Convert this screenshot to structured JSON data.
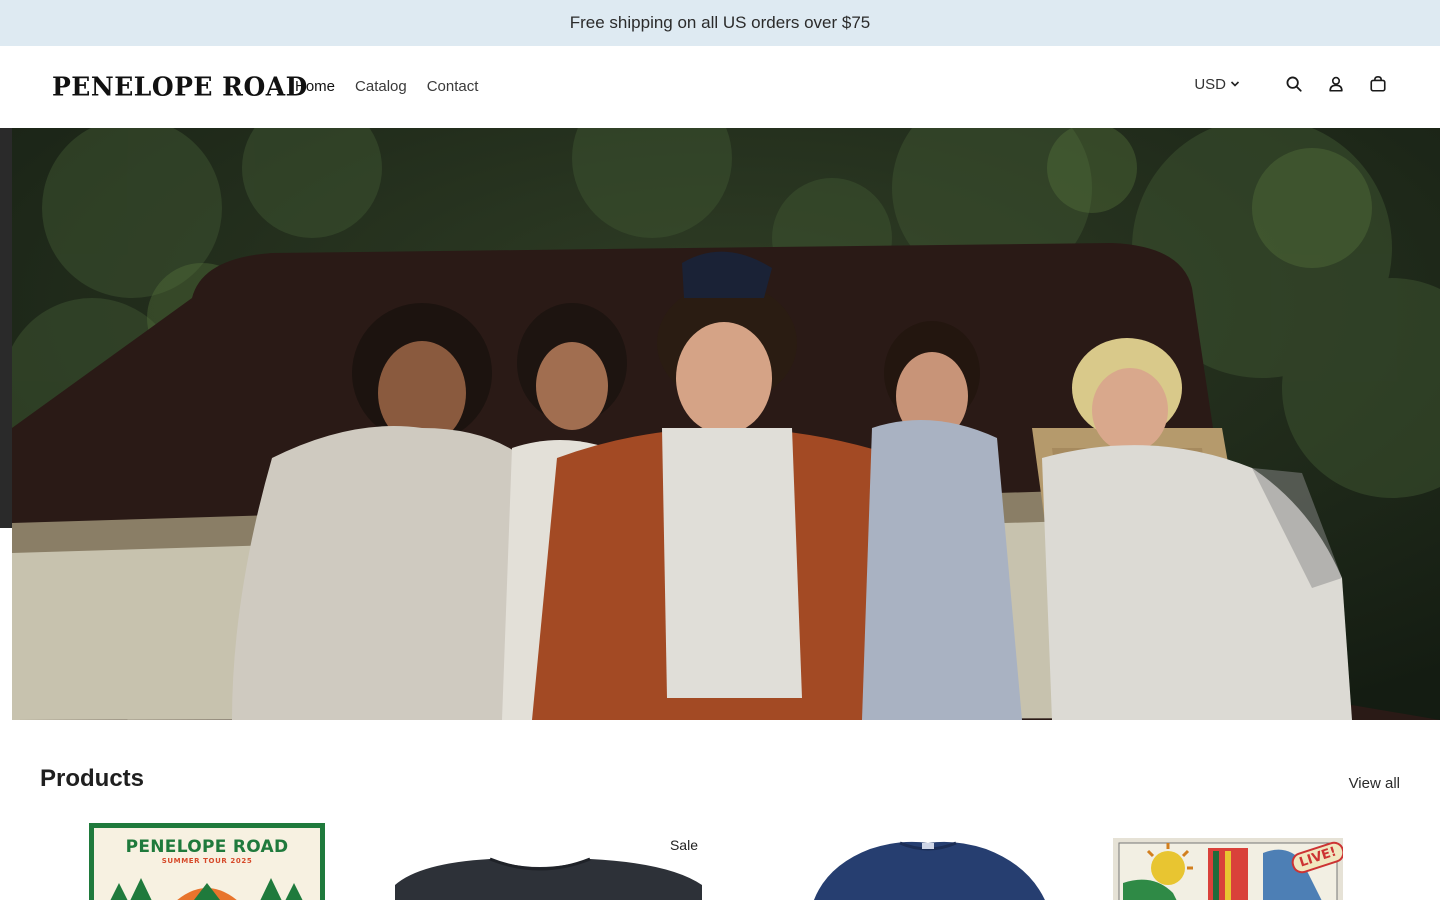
{
  "announcement": {
    "text": "Free shipping on all US orders over $75"
  },
  "header": {
    "logo": "PENELOPE ROAD",
    "nav": [
      {
        "label": "Home",
        "active": true
      },
      {
        "label": "Catalog",
        "active": false
      },
      {
        "label": "Contact",
        "active": false
      }
    ],
    "currency": "USD",
    "icons": [
      "search-icon",
      "account-icon",
      "cart-icon"
    ]
  },
  "hero": {
    "image": "band-photo-by-truck"
  },
  "products": {
    "title": "Products",
    "view_all": "View all",
    "items": [
      {
        "image": "summer-tour-poster",
        "poster_title": "PENELOPE ROAD",
        "poster_subtitle": "SUMMER TOUR 2025"
      },
      {
        "image": "black-tshirt",
        "badge": "Sale"
      },
      {
        "image": "navy-tshirt"
      },
      {
        "image": "live-artwork-print",
        "art_text": "LIVE!"
      }
    ]
  },
  "colors": {
    "announcement_bg": "#deeaf2",
    "poster_green": "#1f7a3c",
    "poster_orange": "#e8742c"
  }
}
